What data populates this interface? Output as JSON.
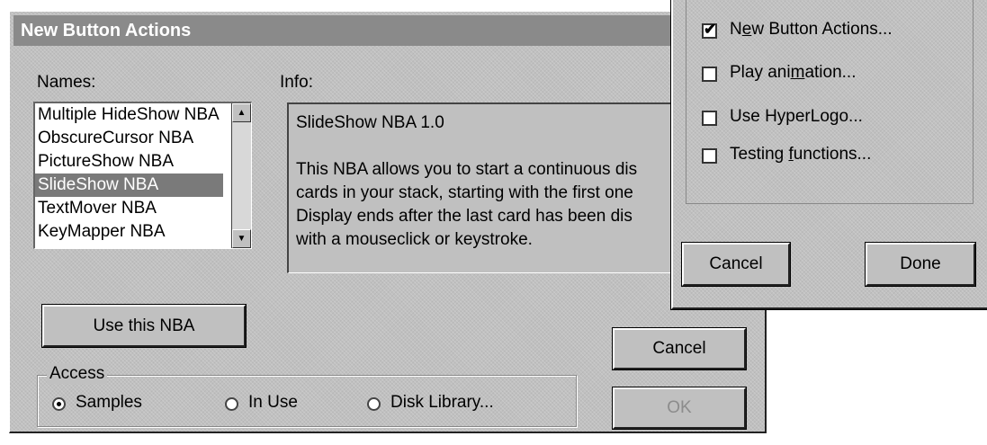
{
  "main_dialog": {
    "title": "New Button Actions",
    "names_label": "Names:",
    "info_label": "Info:",
    "names_list": [
      "Multiple HideShow NBA",
      "ObscureCursor NBA",
      "PictureShow NBA",
      "SlideShow NBA",
      "TextMover NBA",
      "KeyMapper NBA"
    ],
    "selected_name": "SlideShow NBA",
    "info_text": {
      "line1": "SlideShow NBA 1.0",
      "line2": "This NBA allows you to start a continuous dis",
      "line3": "cards in your stack, starting with the first one",
      "line4": "Display ends after the last card has been dis",
      "line5": "with a mouseclick or keystroke."
    },
    "use_button_label": "Use this NBA",
    "cancel_button_label": "Cancel",
    "ok_button_label": "OK",
    "access": {
      "label": "Access",
      "options": [
        "Samples",
        "In Use",
        "Disk Library..."
      ],
      "selected": "Samples"
    }
  },
  "options_dialog": {
    "checkboxes": [
      {
        "pre": "N",
        "key": "e",
        "post": "w Button Actions...",
        "checked": true
      },
      {
        "pre": "Play ani",
        "key": "m",
        "post": "ation...",
        "checked": false
      },
      {
        "pre": "Use HyperLo",
        "key": "g",
        "post": "o...",
        "checked": false
      },
      {
        "pre": "Testing ",
        "key": "f",
        "post": "unctions...",
        "checked": false
      }
    ],
    "cancel_button_label": "Cancel",
    "done_button_label": "Done"
  },
  "colors": {
    "title_bar": "#8a8a8a",
    "dialog_face": "#c0c0c0",
    "selection": "#7a7a7a"
  }
}
